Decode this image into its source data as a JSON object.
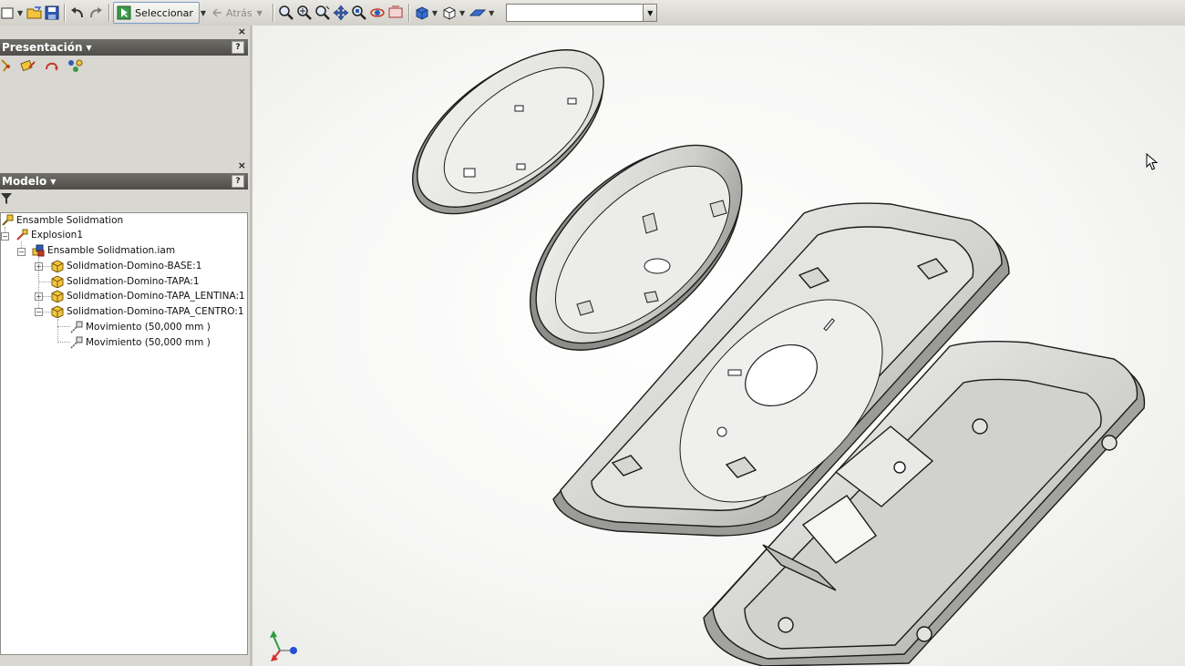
{
  "toolbar": {
    "select_label": "Seleccionar",
    "back_label": "Atrás",
    "combo_value": ""
  },
  "presentation_panel": {
    "title": "Presentación",
    "help": "?"
  },
  "model_panel": {
    "title": "Modelo",
    "help": "?"
  },
  "tree": {
    "root": "Ensamble Solidmation",
    "explosion": "Explosion1",
    "assembly": "Ensamble Solidmation.iam",
    "parts": [
      "Solidmation-Domino-BASE:1",
      "Solidmation-Domino-TAPA:1",
      "Solidmation-Domino-TAPA_LENTINA:1",
      "Solidmation-Domino-TAPA_CENTRO:1"
    ],
    "movements": [
      "Movimiento (50,000 mm )",
      "Movimiento (50,000 mm )"
    ]
  },
  "icons": {
    "new": "new-file-icon",
    "open": "open-folder-icon",
    "save": "save-disk-icon",
    "undo": "undo-icon",
    "redo": "redo-icon",
    "select": "select-cursor-icon",
    "zoom_all": "zoom-all-icon",
    "zoom_window": "zoom-window-icon",
    "zoom": "zoom-icon",
    "pan": "pan-icon",
    "zoom_selected": "zoom-selected-icon",
    "orbit": "orbit-icon",
    "look_at": "look-at-icon",
    "display_mode": "shaded-cube-icon",
    "camera": "camera-cube-icon",
    "ground_plane": "ground-plane-icon"
  },
  "colors": {
    "panel_header": "#55544f",
    "viewport_bg": "#f7f7f6",
    "part_face": "#e6e6e3",
    "part_edge": "#1b1b1b",
    "highlight_box": "#7b9cc9",
    "folder_yellow": "#f2c53b"
  }
}
